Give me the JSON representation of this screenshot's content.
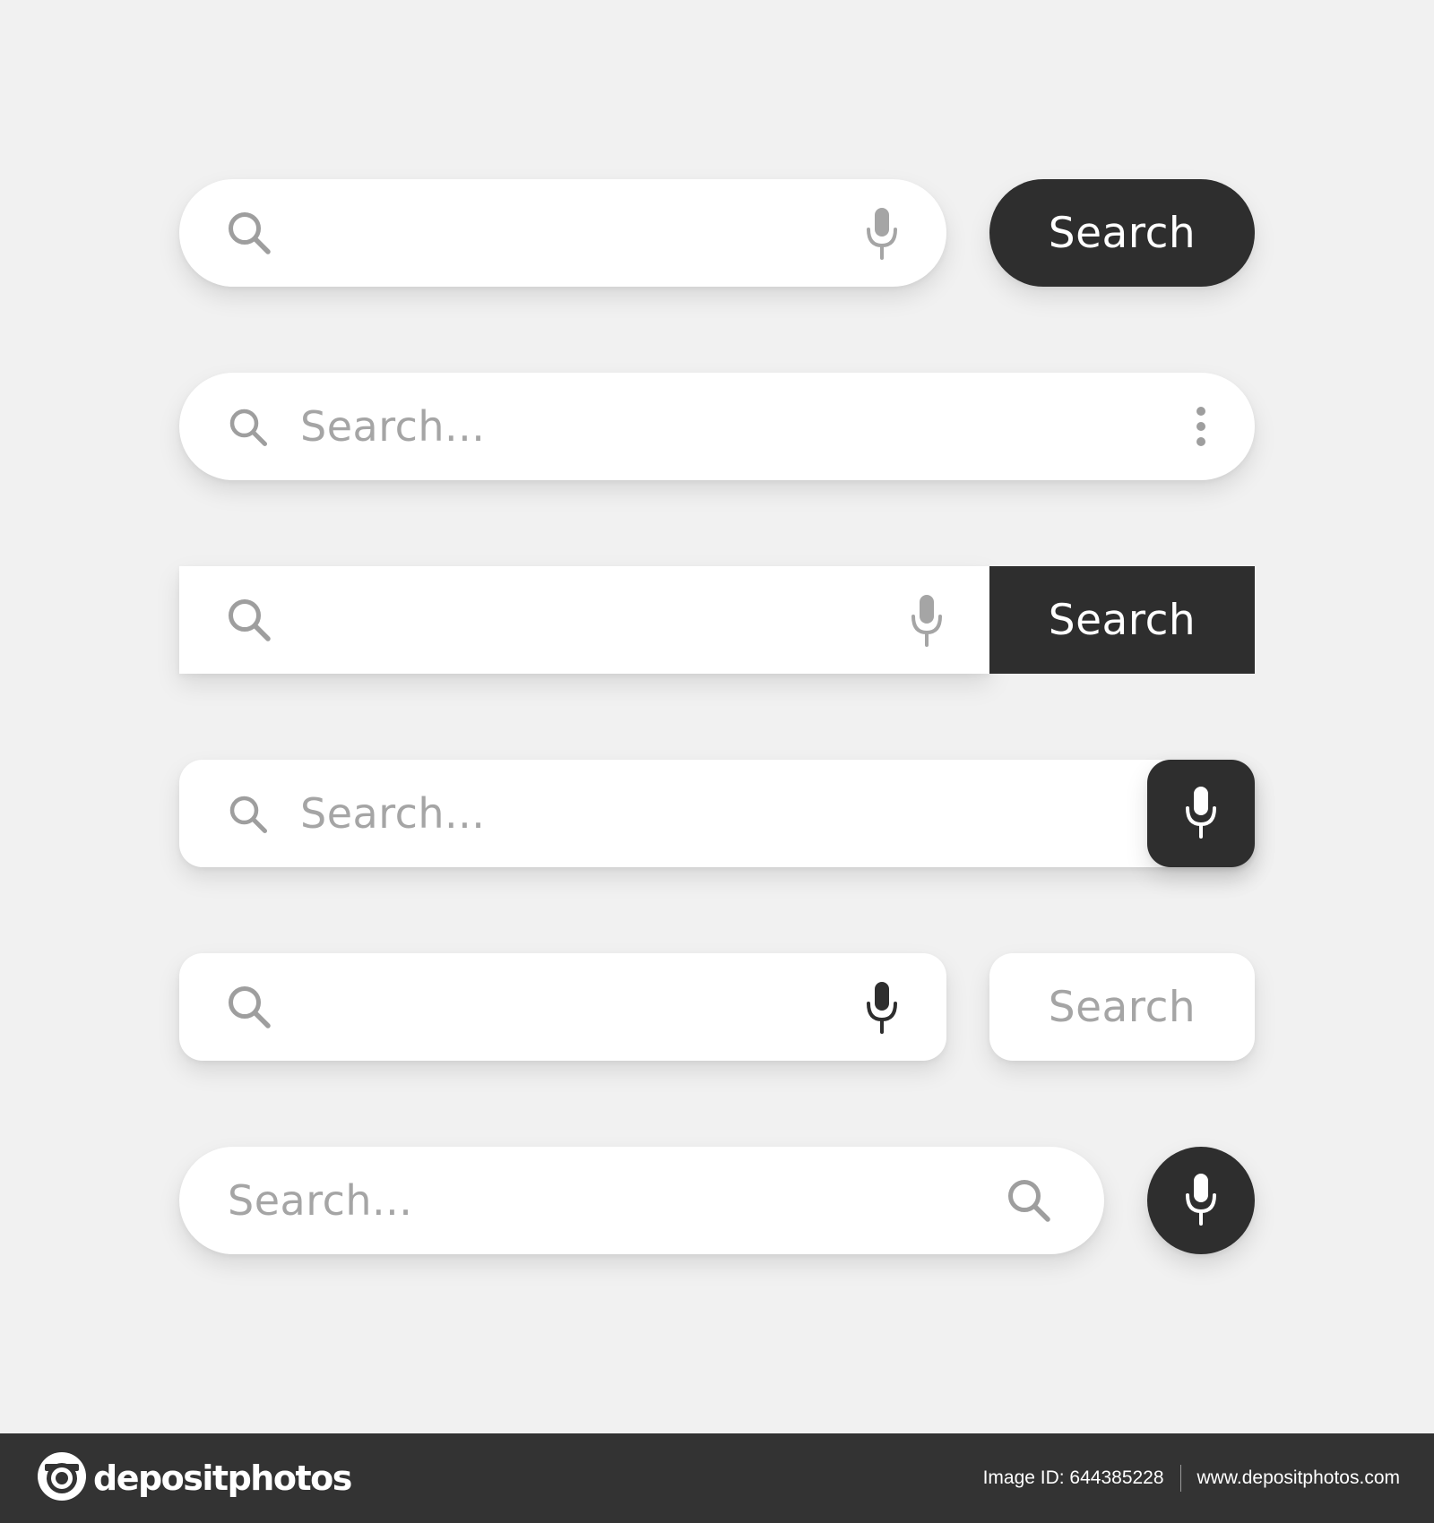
{
  "colors": {
    "background": "#f1f1f1",
    "bar": "#ffffff",
    "dark_button": "#2e2e2e",
    "placeholder_text": "#a5a5a5",
    "footer": "#333333"
  },
  "search_bars": [
    {
      "style": "pill",
      "icons": [
        "search-icon",
        "microphone-icon"
      ],
      "button_label": "Search",
      "button_style": "dark-pill"
    },
    {
      "style": "pill",
      "icons": [
        "search-icon",
        "more-vertical-icon"
      ],
      "placeholder": "Search..."
    },
    {
      "style": "square",
      "icons": [
        "search-icon",
        "microphone-icon"
      ],
      "button_label": "Search",
      "button_style": "dark-square"
    },
    {
      "style": "rounded",
      "icons": [
        "search-icon",
        "microphone-icon"
      ],
      "placeholder": "Search...",
      "button_style": "dark-rounded-mic"
    },
    {
      "style": "rounded",
      "icons": [
        "search-icon",
        "microphone-icon"
      ],
      "button_label": "Search",
      "button_style": "light-rounded"
    },
    {
      "style": "pill",
      "icons": [
        "search-icon",
        "microphone-icon"
      ],
      "placeholder": "Search...",
      "button_style": "dark-circle-mic"
    }
  ],
  "footer": {
    "brand": "depositphotos",
    "image_id": "Image ID: 644385228",
    "website": "www.depositphotos.com"
  }
}
